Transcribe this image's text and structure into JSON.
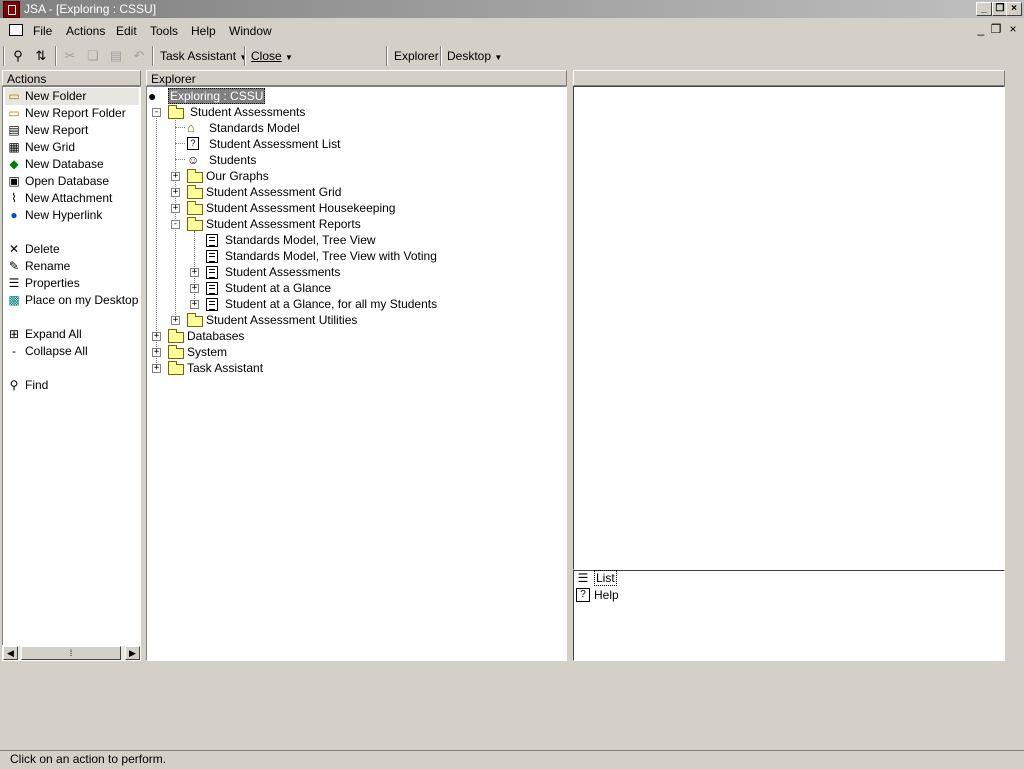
{
  "window": {
    "title": "JSA - [Exploring : CSSU]"
  },
  "menu": {
    "items": [
      "File",
      "Actions",
      "Edit",
      "Tools",
      "Help",
      "Window"
    ]
  },
  "toolbar": {
    "task_assistant": "Task Assistant",
    "close": "Close",
    "explorer": "Explorer",
    "desktop": "Desktop"
  },
  "actions": {
    "header": "Actions",
    "items": [
      {
        "label": "New Folder",
        "icon": "new-folder-icon"
      },
      {
        "label": "New Report Folder",
        "icon": "report-folder-icon"
      },
      {
        "label": "New Report",
        "icon": "report-icon"
      },
      {
        "label": "New Grid",
        "icon": "grid-icon"
      },
      {
        "label": "New Database",
        "icon": "database-icon"
      },
      {
        "label": "Open Database",
        "icon": "open-database-icon"
      },
      {
        "label": "New Attachment",
        "icon": "attachment-icon"
      },
      {
        "label": "New Hyperlink",
        "icon": "hyperlink-icon"
      },
      {
        "label": "Delete",
        "icon": "delete-icon"
      },
      {
        "label": "Rename",
        "icon": "rename-icon"
      },
      {
        "label": "Properties",
        "icon": "properties-icon"
      },
      {
        "label": "Place on my Desktop",
        "icon": "desktop-icon"
      },
      {
        "label": "Expand All",
        "icon": "expand-icon"
      },
      {
        "label": "Collapse All",
        "icon": "collapse-icon"
      },
      {
        "label": "Find",
        "icon": "find-icon"
      }
    ]
  },
  "explorer": {
    "header": "Explorer",
    "root": "Exploring : CSSU",
    "nodes": [
      "Student Assessments",
      "Standards Model",
      "Student Assessment List",
      "Students",
      "Our Graphs",
      "Student Assessment Grid",
      "Student Assessment Housekeeping",
      "Student Assessment Reports",
      "Standards Model, Tree View",
      "Standards Model, Tree View with Voting",
      "Student Assessments",
      "Student at a Glance",
      "Student at a Glance, for all my Students",
      "Student Assessment Utilities",
      "Databases",
      "System",
      "Task Assistant"
    ]
  },
  "right": {
    "items": [
      "List",
      "Help"
    ]
  },
  "status": {
    "text": "Click on an action to perform."
  }
}
